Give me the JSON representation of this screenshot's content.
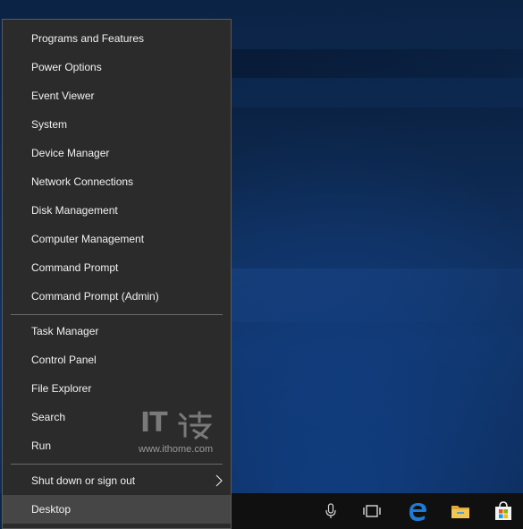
{
  "menu": {
    "items_group1": [
      "Programs and Features",
      "Power Options",
      "Event Viewer",
      "System",
      "Device Manager",
      "Network Connections",
      "Disk Management",
      "Computer Management",
      "Command Prompt",
      "Command Prompt (Admin)"
    ],
    "items_group2": [
      "Task Manager",
      "Control Panel",
      "File Explorer",
      "Search",
      "Run"
    ],
    "shutdown": "Shut down or sign out",
    "desktop": "Desktop"
  },
  "watermark": {
    "brand": "IT",
    "url": "www.ithome.com"
  },
  "taskbar": {
    "icons": [
      "microphone-icon",
      "task-view-icon",
      "edge-icon",
      "file-explorer-icon",
      "store-icon"
    ],
    "colors": {
      "edge": "#1e7bd6",
      "folder": "#f4c652",
      "background": "#101010"
    }
  }
}
